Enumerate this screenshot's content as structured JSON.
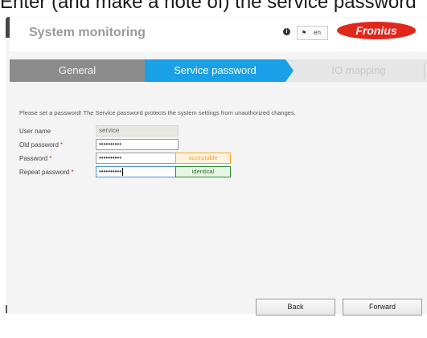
{
  "caption": "Enter (and make a note of) the service password",
  "header": {
    "title": "System monitoring",
    "info_icon": "i",
    "language": "en",
    "logo_text": "Fronius",
    "brand_color": "#e1261c"
  },
  "tabs": [
    {
      "label": "General",
      "state": "completed"
    },
    {
      "label": "Service password",
      "state": "active"
    },
    {
      "label": "IO mapping",
      "state": "disabled"
    }
  ],
  "form": {
    "intro": "Please set a password! The Service password protects the system settings from unauthorized changes.",
    "user_name": {
      "label": "User name",
      "value": "service"
    },
    "old_password": {
      "label": "Old password",
      "value": "••••••••••"
    },
    "password": {
      "label": "Password",
      "value": "••••••••••",
      "status": "acceptable"
    },
    "repeat_password": {
      "label": "Repeat password",
      "value": "••••••••••",
      "status": "identical"
    },
    "required_mark": "*"
  },
  "buttons": {
    "back": "Back",
    "forward": "Forward"
  }
}
